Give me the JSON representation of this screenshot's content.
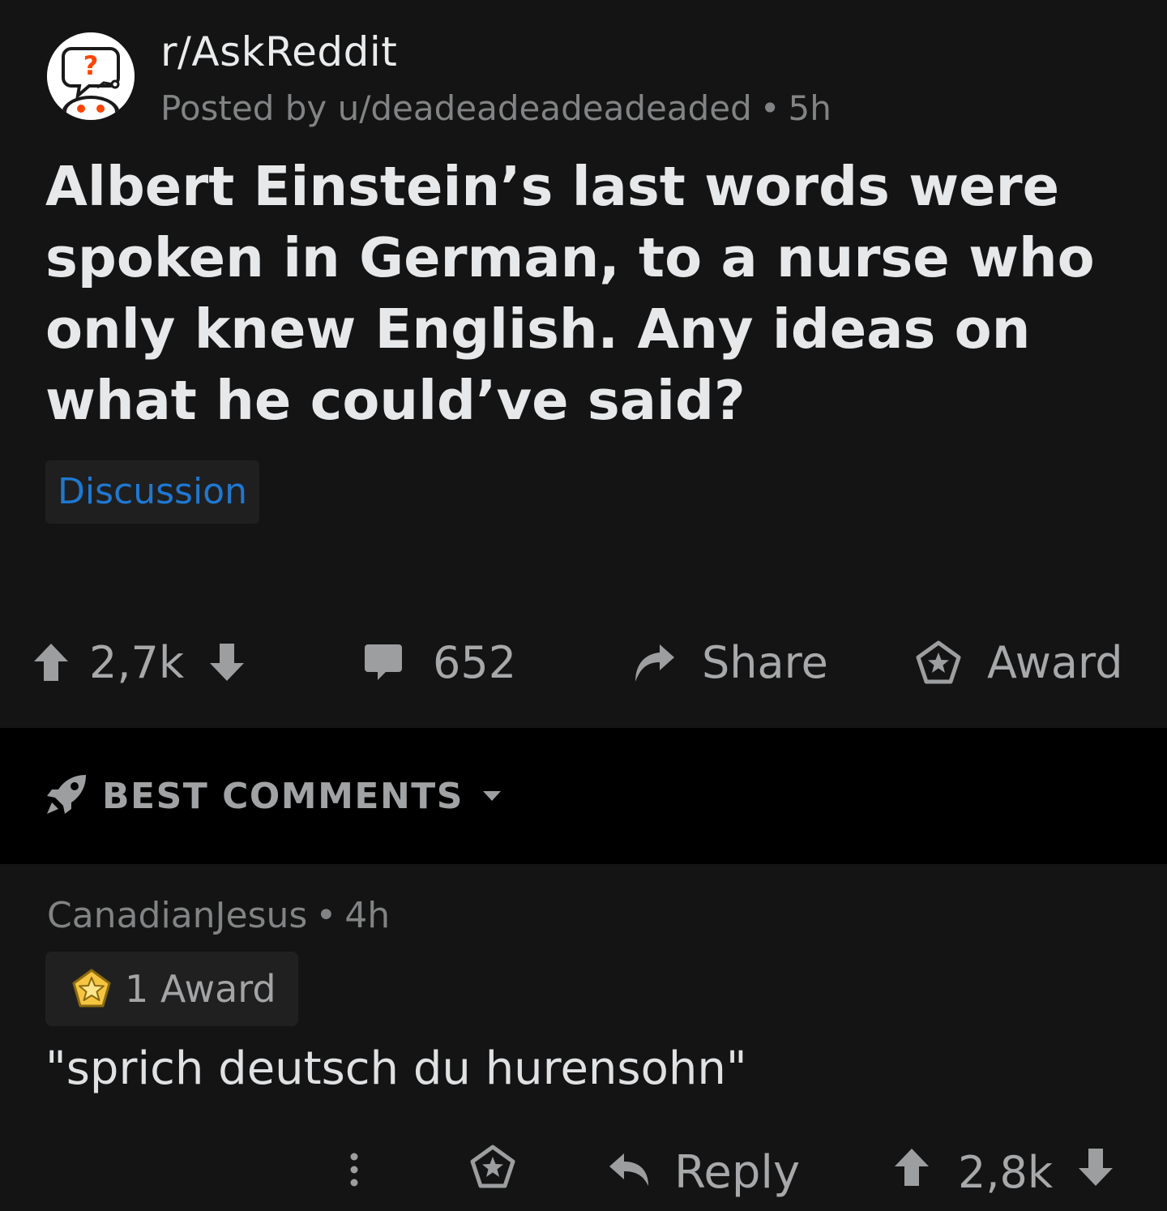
{
  "post": {
    "subreddit": "r/AskReddit",
    "posted_by_prefix": "Posted by",
    "author": "u/deadeadeadeadeaded",
    "separator": "•",
    "age": "5h",
    "title": "Albert Einstein’s last words were spoken in German, to a nurse who only knew English. Any ideas on what he could’ve said?",
    "flair": "Discussion",
    "flair_color": "#1f78d1",
    "vote_count": "2,7k",
    "comment_count": "652",
    "share_label": "Share",
    "award_label": "Award"
  },
  "sort": {
    "label": "BEST COMMENTS",
    "icon": "rocket-icon"
  },
  "comment": {
    "author": "CanadianJesus",
    "separator": "•",
    "age": "4h",
    "awards_label": "1 Award",
    "body": "\"sprich deutsch du hurensohn\"",
    "reply_label": "Reply",
    "vote_count": "2,8k"
  },
  "colors": {
    "background": "#141414",
    "sort_bar_background": "#000000",
    "subreddit_icon_accent": "#ff4500"
  }
}
